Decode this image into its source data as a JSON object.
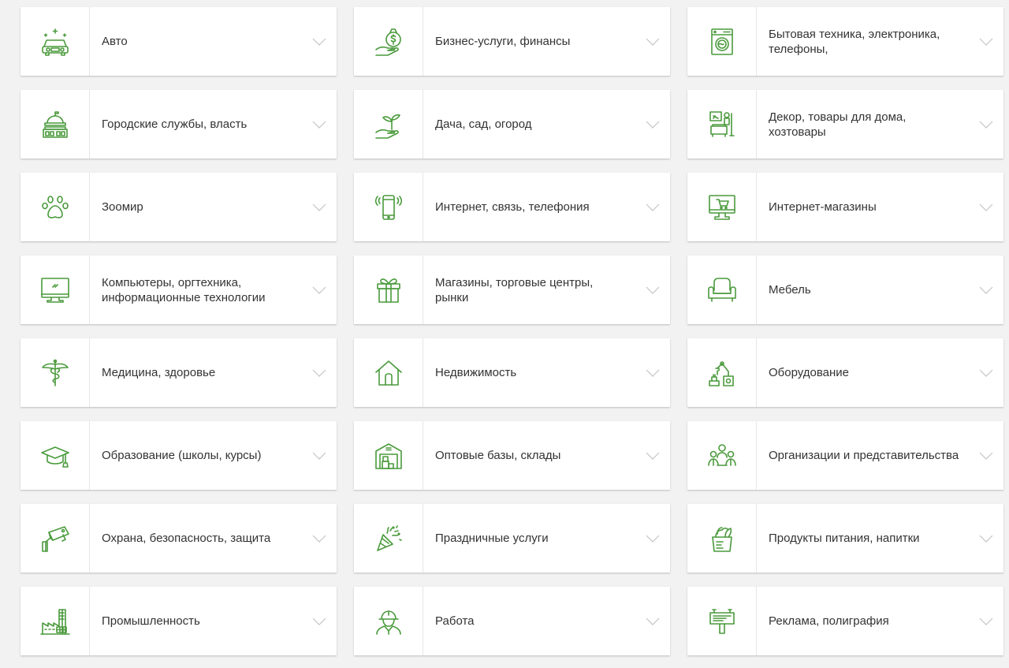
{
  "theme": {
    "accent": "#4a9a3c",
    "tile_bg": "#ffffff",
    "page_bg": "#f2f2f2",
    "text": "#333333",
    "chevron": "#c4c4c4"
  },
  "categories": [
    {
      "label": "Авто",
      "icon": "car-icon"
    },
    {
      "label": "Бизнес-услуги, финансы",
      "icon": "money-hand-icon"
    },
    {
      "label": "Бытовая техника, электроника, телефоны,",
      "icon": "washing-machine-icon"
    },
    {
      "label": "Городские службы, власть",
      "icon": "government-building-icon"
    },
    {
      "label": "Дача, сад, огород",
      "icon": "sprout-hand-icon"
    },
    {
      "label": "Декор, товары для дома, хозтовары",
      "icon": "home-decor-icon"
    },
    {
      "label": "Зоомир",
      "icon": "paw-icon"
    },
    {
      "label": "Интернет, связь, телефония",
      "icon": "smartphone-signal-icon"
    },
    {
      "label": "Интернет-магазины",
      "icon": "monitor-cart-icon"
    },
    {
      "label": "Компьютеры, оргтехника, информационные технологии",
      "icon": "computer-monitor-icon"
    },
    {
      "label": "Магазины, торговые центры, рынки",
      "icon": "gift-box-icon"
    },
    {
      "label": "Мебель",
      "icon": "armchair-icon"
    },
    {
      "label": "Медицина, здоровье",
      "icon": "caduceus-icon"
    },
    {
      "label": "Недвижимость",
      "icon": "house-icon"
    },
    {
      "label": "Оборудование",
      "icon": "robot-arm-icon"
    },
    {
      "label": "Образование (школы, курсы)",
      "icon": "graduation-cap-icon"
    },
    {
      "label": "Оптовые базы, склады",
      "icon": "warehouse-icon"
    },
    {
      "label": "Организации и представительства",
      "icon": "people-group-icon"
    },
    {
      "label": "Охрана, безопасность, защита",
      "icon": "security-camera-icon"
    },
    {
      "label": "Праздничные услуги",
      "icon": "party-popper-icon"
    },
    {
      "label": "Продукты питания, напитки",
      "icon": "grocery-bag-icon"
    },
    {
      "label": "Промышленность",
      "icon": "factory-icon"
    },
    {
      "label": "Работа",
      "icon": "worker-helmet-icon"
    },
    {
      "label": "Реклама, полиграфия",
      "icon": "billboard-icon"
    }
  ]
}
